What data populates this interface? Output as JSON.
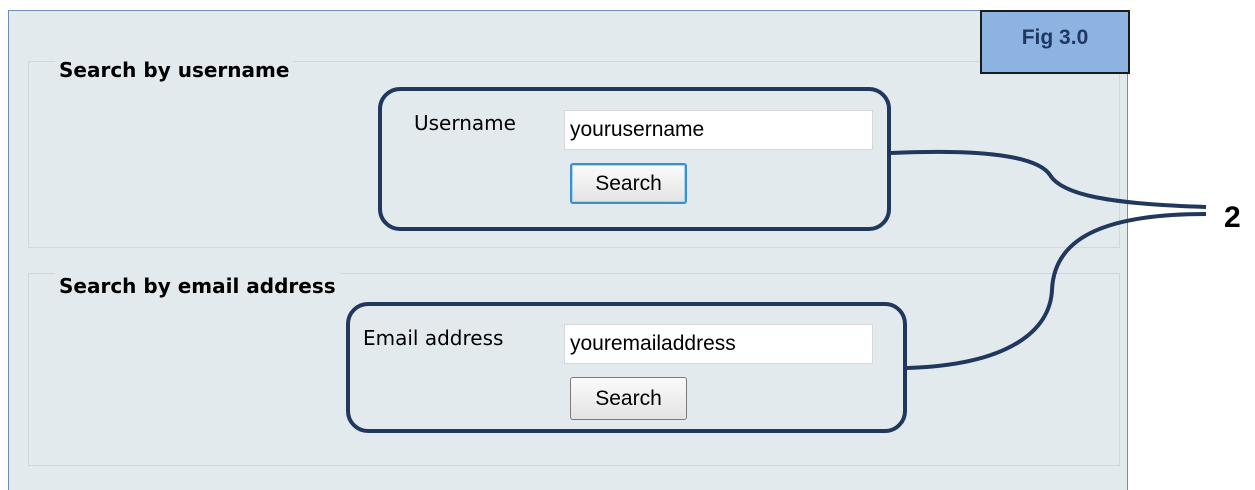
{
  "figure_label": "Fig 3.0",
  "callout_number": "2",
  "search_by_username": {
    "legend": "Search by username",
    "field_label": "Username",
    "input_value": "yourusername",
    "button_label": "Search"
  },
  "search_by_email": {
    "legend": "Search by email address",
    "field_label": "Email address",
    "input_value": "youremailaddress",
    "button_label": "Search"
  },
  "colors": {
    "panel_background": "#e2eaed",
    "callout_outline": "#20375e",
    "figure_label_fill": "#8db3e2",
    "focused_button_border": "#3c90c9"
  }
}
